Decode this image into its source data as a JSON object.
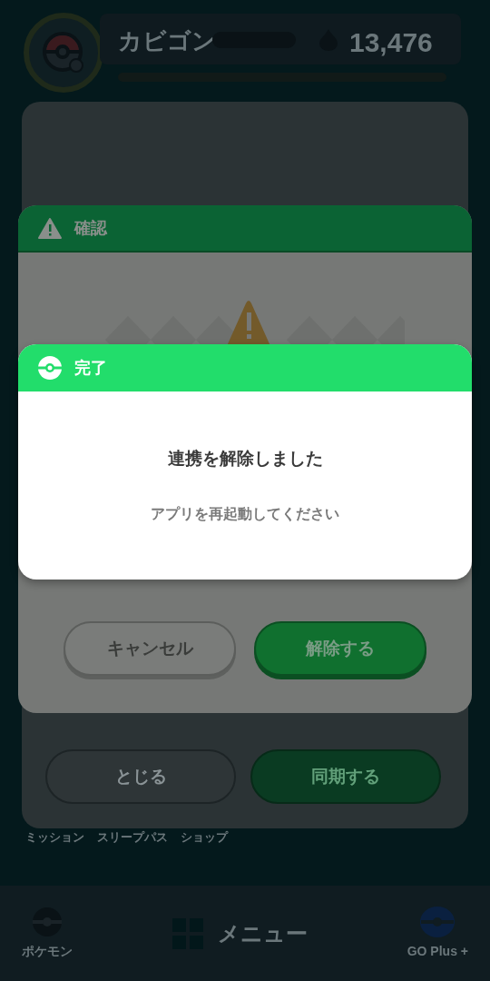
{
  "header": {
    "name": "カビゴン",
    "energy": "13,476"
  },
  "sync_sheet": {
    "buttons": [
      {
        "label": "とじる",
        "kind": "secondary"
      },
      {
        "label": "同期する",
        "kind": "primary"
      }
    ]
  },
  "shortcuts": [
    "ミッション",
    "スリープパス",
    "ショップ"
  ],
  "confirm_dialog": {
    "title": "確認",
    "buttons": [
      {
        "label": "キャンセル",
        "kind": "secondary"
      },
      {
        "label": "解除する",
        "kind": "primary"
      }
    ]
  },
  "complete_dialog": {
    "title": "完了",
    "message": "連携を解除しました",
    "note": "アプリを再起動してください"
  },
  "bottom_nav": [
    {
      "label": "ポケモン",
      "kind": "pokemon"
    },
    {
      "label": "メニュー",
      "kind": "menu"
    },
    {
      "label": "GO Plus +",
      "kind": "goplus"
    }
  ]
}
